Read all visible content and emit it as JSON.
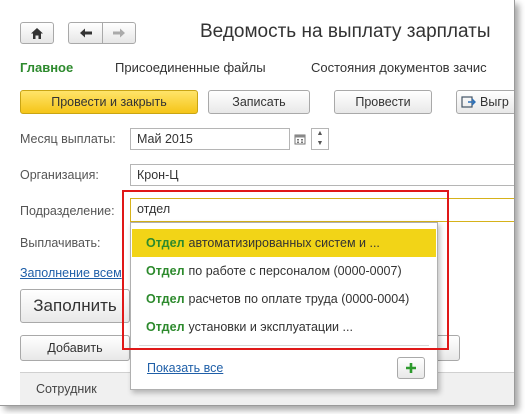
{
  "window": {
    "title": "Ведомость на выплату зарплаты"
  },
  "nav": {
    "home_icon": "home-icon",
    "back_icon": "arrow-left-icon",
    "forward_icon": "arrow-right-icon"
  },
  "tabs": [
    {
      "label": "Главное",
      "active": true
    },
    {
      "label": "Присоединенные файлы",
      "active": false
    },
    {
      "label": "Состояния документов зачис",
      "active": false
    }
  ],
  "toolbar": {
    "post_close": "Провести и закрыть",
    "save": "Записать",
    "post": "Провести",
    "unload": "Выгр"
  },
  "form": {
    "month_label": "Месяц выплаты:",
    "month_value": "Май 2015",
    "org_label": "Организация:",
    "org_value": "Крон-Ц",
    "dept_label": "Подразделение:",
    "dept_value": "отдел",
    "pay_label": "Выплачивать:",
    "fill_link": "Заполнение всем"
  },
  "actions": {
    "fill": "Заполнить",
    "add": "Добавить"
  },
  "table": {
    "col_employee": "Сотрудник"
  },
  "dropdown": {
    "items": [
      {
        "match": "Отдел",
        "rest": "автоматизированных систем и ..."
      },
      {
        "match": "Отдел",
        "rest": "по работе с персоналом (0000-0007)"
      },
      {
        "match": "Отдел",
        "rest": "расчетов по оплате труда (0000-0004)"
      },
      {
        "match": "Отдел",
        "rest": "установки и эксплуатации ..."
      }
    ],
    "selected_index": 0,
    "show_all": "Показать все"
  },
  "colors": {
    "accent_green": "#2d8a2d",
    "primary_yellow": "#f5c518",
    "highlight": "#e01818",
    "link": "#1f5fa8"
  }
}
